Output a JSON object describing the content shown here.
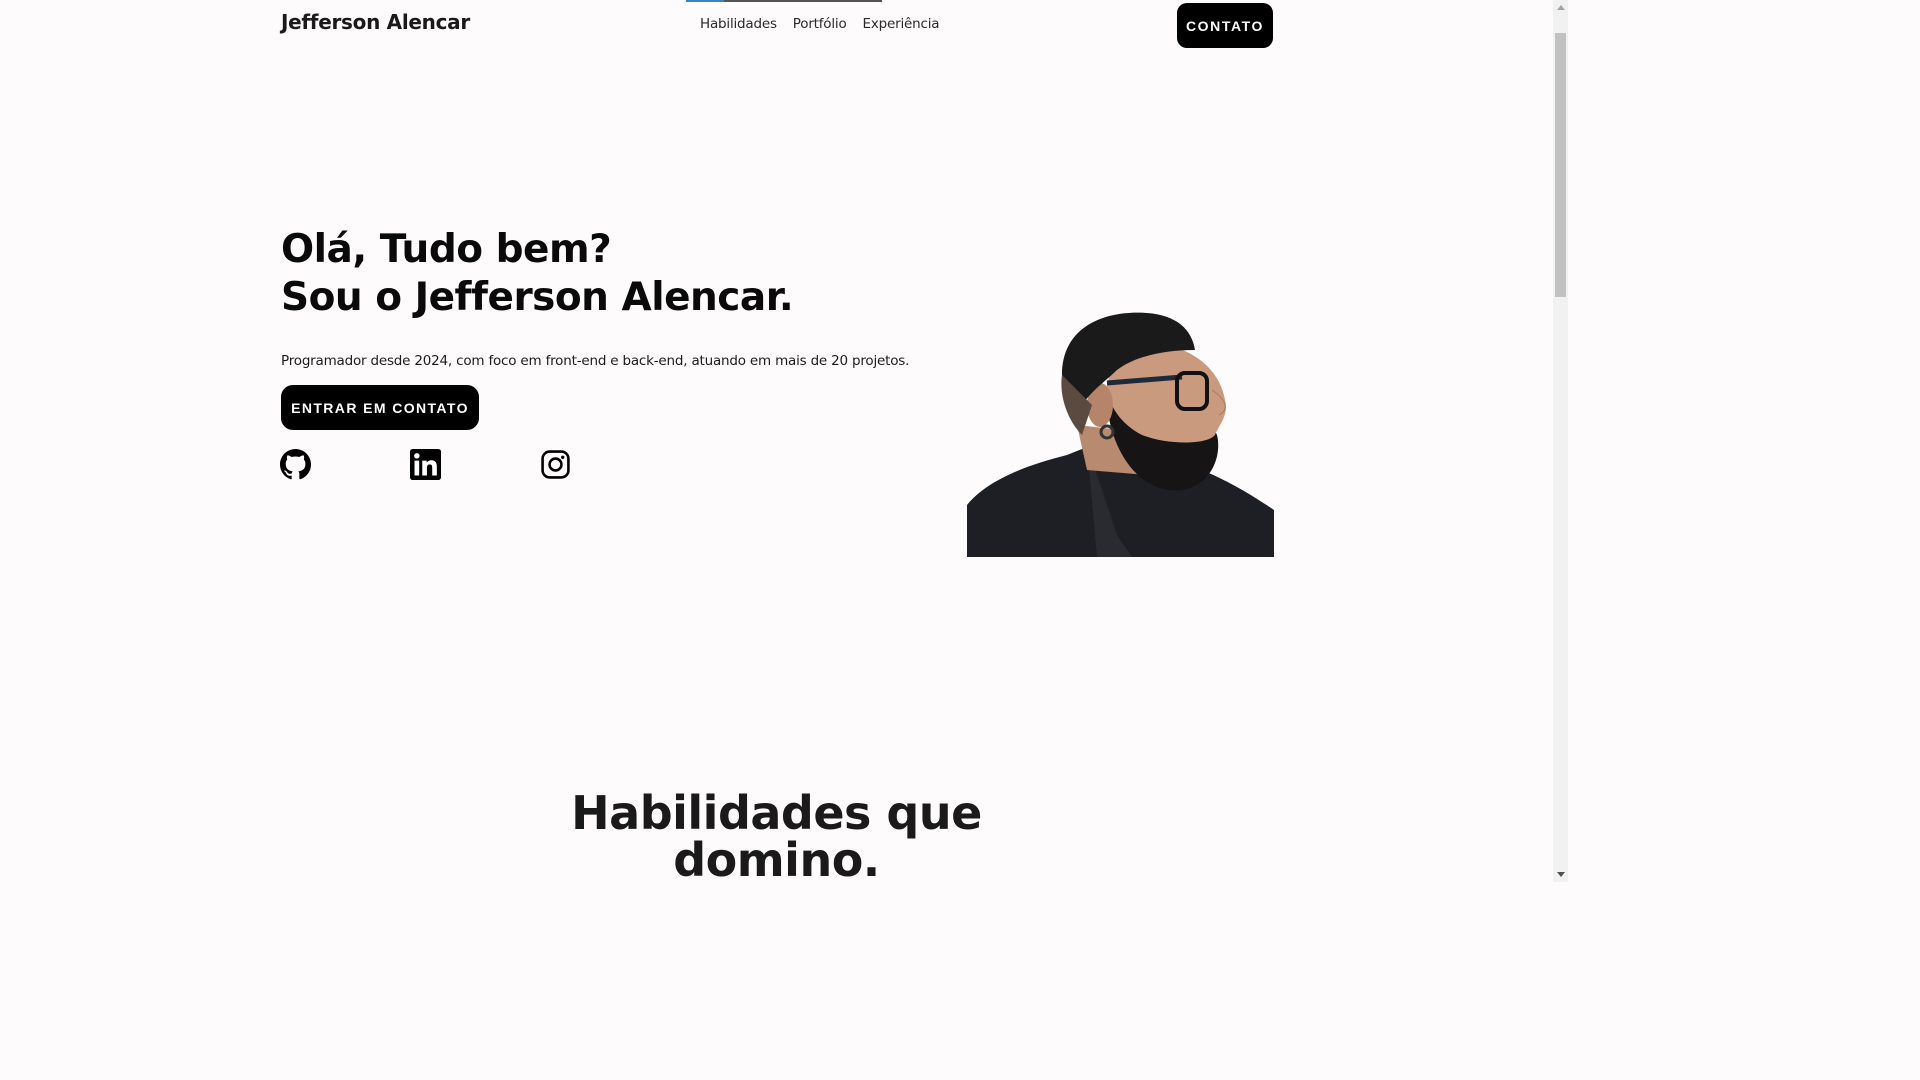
{
  "header": {
    "brand": "Jefferson Alencar",
    "nav": [
      "Habilidades",
      "Portfólio",
      "Experiência"
    ],
    "contact_label": "CONTATO"
  },
  "hero": {
    "title_line1": "Olá, Tudo bem?",
    "title_line2": "Sou o Jefferson Alencar.",
    "description": "Programador desde 2024, com foco em front-end e back-end, atuando em mais de 20 projetos.",
    "cta_label": "ENTRAR EM CONTATO",
    "social_icons": [
      "github-icon",
      "linkedin-icon",
      "instagram-icon"
    ]
  },
  "skills_section": {
    "title_line1": "Habilidades que",
    "title_line2": "domino."
  },
  "colors": {
    "background": "#fdfbfb",
    "button": "#000000",
    "nav_active_indicator": "#3b82c4"
  }
}
